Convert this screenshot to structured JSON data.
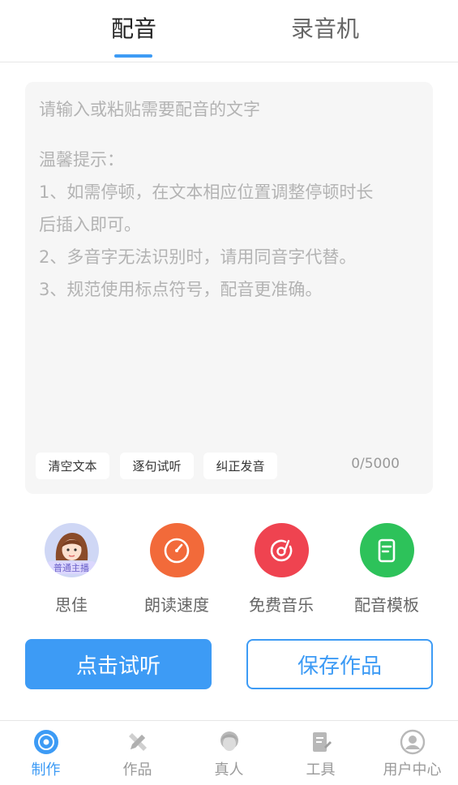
{
  "top_tabs": {
    "dubbing": "配音",
    "recorder": "录音机"
  },
  "editor": {
    "placeholder_title": "请输入或粘贴需要配音的文字",
    "tip_title": "温馨提示：",
    "tip_1a": "1、如需停顿，在文本相应位置调整停顿时长",
    "tip_1b": "后插入即可。",
    "tip_2": "2、多音字无法识别时，请用同音字代替。",
    "tip_3": "3、规范使用标点符号，配音更准确。",
    "char_count": "0/5000",
    "chips": {
      "clear": "清空文本",
      "sentence": "逐句试听",
      "correct": "纠正发音"
    }
  },
  "features": {
    "voice_badge": "普通主播",
    "voice_name": "思佳",
    "speed": "朗读速度",
    "music": "免费音乐",
    "template": "配音模板"
  },
  "actions": {
    "listen": "点击试听",
    "save": "保存作品"
  },
  "bottom_nav": {
    "make": "制作",
    "works": "作品",
    "human": "真人",
    "tools": "工具",
    "user": "用户中心"
  },
  "colors": {
    "accent": "#3d9bf5",
    "speed": "#f26a3a",
    "music": "#ef4350",
    "template": "#2dc25a"
  }
}
